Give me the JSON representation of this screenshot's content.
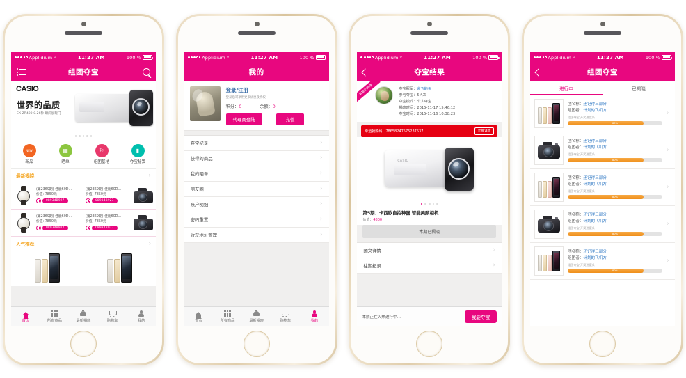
{
  "statusbar": {
    "carrier": "Applidium",
    "time": "11:27 AM",
    "battery": "100 %"
  },
  "phone1": {
    "nav_title": "组团夺宝",
    "menu_icon": "menu-icon",
    "search_icon": "search-icon",
    "banner": {
      "logo": "CASIO",
      "title": "世界的品质",
      "subtitle": "EX-ZR400-0.26秒 瞬间展现门"
    },
    "quicknav": [
      {
        "label": "新品",
        "color": "#f26522",
        "glyph": "NEW"
      },
      {
        "label": "晒单",
        "color": "#8cc63f",
        "glyph": "▤"
      },
      {
        "label": "组团基地",
        "color": "#e8386b",
        "glyph": "⚑"
      },
      {
        "label": "夺宝秘笈",
        "color": "#00bfae",
        "glyph": "▮"
      }
    ],
    "section_latest": "最新揭晓",
    "section_hot": "人气推荐",
    "products": [
      {
        "name": "(第2369期) 佳能60D...",
        "price": "价值: 7850元",
        "code": "08934B927",
        "thumb": "watch"
      },
      {
        "name": "(第2369期) 佳能60D...",
        "price": "价值: 7850元",
        "code": "08934B927",
        "thumb": "camera"
      },
      {
        "name": "(第2369期) 佳能60D...",
        "price": "价值: 7850元",
        "code": "08934B927",
        "thumb": "watch"
      },
      {
        "name": "(第2369期) 佳能60D...",
        "price": "价值: 7850元",
        "code": "08934B927",
        "thumb": "camera"
      }
    ],
    "tabbar": [
      {
        "label": "首页",
        "icon": "home-icon",
        "active": true
      },
      {
        "label": "所有商品",
        "icon": "grid-icon",
        "active": false
      },
      {
        "label": "最新揭晓",
        "icon": "bell-icon",
        "active": false
      },
      {
        "label": "购物车",
        "icon": "cart-icon",
        "active": false
      },
      {
        "label": "我的",
        "icon": "user-icon",
        "active": false
      }
    ]
  },
  "phone2": {
    "nav_title": "我的",
    "profile": {
      "login": "登录/注册",
      "hint": "登录后可享用更多优惠及特权",
      "points_label": "积分：",
      "points_value": "0",
      "balance_label": "余额：",
      "balance_value": "0",
      "agent_button": "代理商登陆",
      "recharge_button": "充值"
    },
    "menu": [
      "夺宝纪录",
      "获得的商品",
      "我的晒单",
      "朋友圈",
      "账户明细",
      "密码重置",
      "收获地址管理"
    ],
    "tabbar": [
      {
        "label": "首页",
        "icon": "home-icon",
        "active": false
      },
      {
        "label": "所有商品",
        "icon": "grid-icon",
        "active": false
      },
      {
        "label": "最新揭晓",
        "icon": "bell-icon",
        "active": false
      },
      {
        "label": "购物车",
        "icon": "cart-icon",
        "active": false
      },
      {
        "label": "我的",
        "icon": "user-icon",
        "active": true
      }
    ]
  },
  "phone3": {
    "nav_title": "夺宝结果",
    "back_icon": "back-chevron-icon",
    "ribbon": "本期已揭晓",
    "winner": [
      {
        "label": "夺宝冠军：",
        "value": "会飞的鱼",
        "link": true
      },
      {
        "label": "参与夺宝：",
        "value": "5人次",
        "link": false
      },
      {
        "label": "夺宝模式：",
        "value": "个人夺宝",
        "link": false
      },
      {
        "label": "揭晓时间：",
        "value": "2015-11-17 15:46:12",
        "link": false
      },
      {
        "label": "夺宝时间：",
        "value": "2015-11-16 10:38:23",
        "link": false
      }
    ],
    "code_label": "幸运抢购码：78658247575237537",
    "code_button": "计算详情",
    "product_title": "第5期：卡西欧自拍神器 智能美颜相机",
    "price_label": "价值：",
    "price_value": "4800",
    "revealed_button": "本期已揭晓",
    "links": [
      "图文详情",
      "往期纪录"
    ],
    "footer_text": "本期正在火热进行中...",
    "footer_button": "我要夺宝"
  },
  "phone4": {
    "nav_title": "组团夺宝",
    "back_icon": "back-chevron-icon",
    "tabs": [
      {
        "label": "进行中",
        "active": true
      },
      {
        "label": "已揭晓",
        "active": false
      }
    ],
    "rows": [
      {
        "name_label": "团名称：",
        "name_value": "还记得三部分",
        "owner_label": "组团者：",
        "owner_value": "计划的飞机方",
        "progress_label": "组团夺宝 开奖进度条",
        "progress": 80,
        "progress_text": "80%",
        "thumb": "iphone"
      },
      {
        "name_label": "团名称：",
        "name_value": "还记得三部分",
        "owner_label": "组团者：",
        "owner_value": "计划的飞机方",
        "progress_label": "组团夺宝 开奖进度条",
        "progress": 80,
        "progress_text": "80%",
        "thumb": "camera"
      },
      {
        "name_label": "团名称：",
        "name_value": "还记得三部分",
        "owner_label": "组团者：",
        "owner_value": "计划的飞机方",
        "progress_label": "组团夺宝 开奖进度条",
        "progress": 80,
        "progress_text": "80%",
        "thumb": "iphone"
      },
      {
        "name_label": "团名称：",
        "name_value": "还记得三部分",
        "owner_label": "组团者：",
        "owner_value": "计划的飞机方",
        "progress_label": "组团夺宝 开奖进度条",
        "progress": 80,
        "progress_text": "80%",
        "thumb": "camera"
      },
      {
        "name_label": "团名称：",
        "name_value": "还记得三部分",
        "owner_label": "组团者：",
        "owner_value": "计划的飞机方",
        "progress_label": "组团夺宝 开奖进度条",
        "progress": 80,
        "progress_text": "80%",
        "thumb": "iphone"
      }
    ]
  },
  "theme": {
    "brand_pink": "#e8077f",
    "link_blue": "#2f78c4",
    "orange": "#ef8f1a",
    "red": "#e60012",
    "section_gold": "#f5a623"
  }
}
